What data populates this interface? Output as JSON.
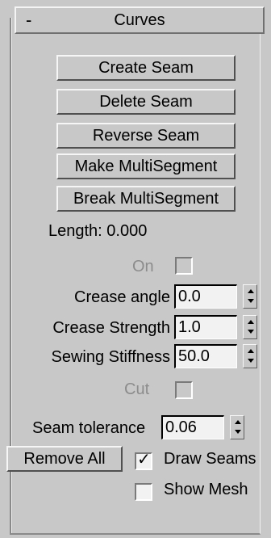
{
  "rollout": {
    "toggle": "-",
    "title": "Curves"
  },
  "buttons": {
    "create_seam": "Create Seam",
    "delete_seam": "Delete Seam",
    "reverse_seam": "Reverse Seam",
    "make_multisegment": "Make MultiSegment",
    "break_multisegment": "Break MultiSegment",
    "remove_all": "Remove All"
  },
  "length": {
    "label": "Length:",
    "value": "0.000"
  },
  "on": {
    "label": "On",
    "checked": false,
    "enabled": false
  },
  "crease_angle": {
    "label": "Crease angle",
    "value": "0.0"
  },
  "crease_strength": {
    "label": "Crease Strength",
    "value": "1.0"
  },
  "sewing_stiffness": {
    "label": "Sewing Stiffness",
    "value": "50.0"
  },
  "cut": {
    "label": "Cut",
    "checked": false,
    "enabled": false
  },
  "seam_tolerance": {
    "label": "Seam tolerance",
    "value": "0.06"
  },
  "draw_seams": {
    "label": "Draw Seams",
    "checked": true,
    "mark": "✓"
  },
  "show_mesh": {
    "label": "Show Mesh",
    "checked": false
  }
}
